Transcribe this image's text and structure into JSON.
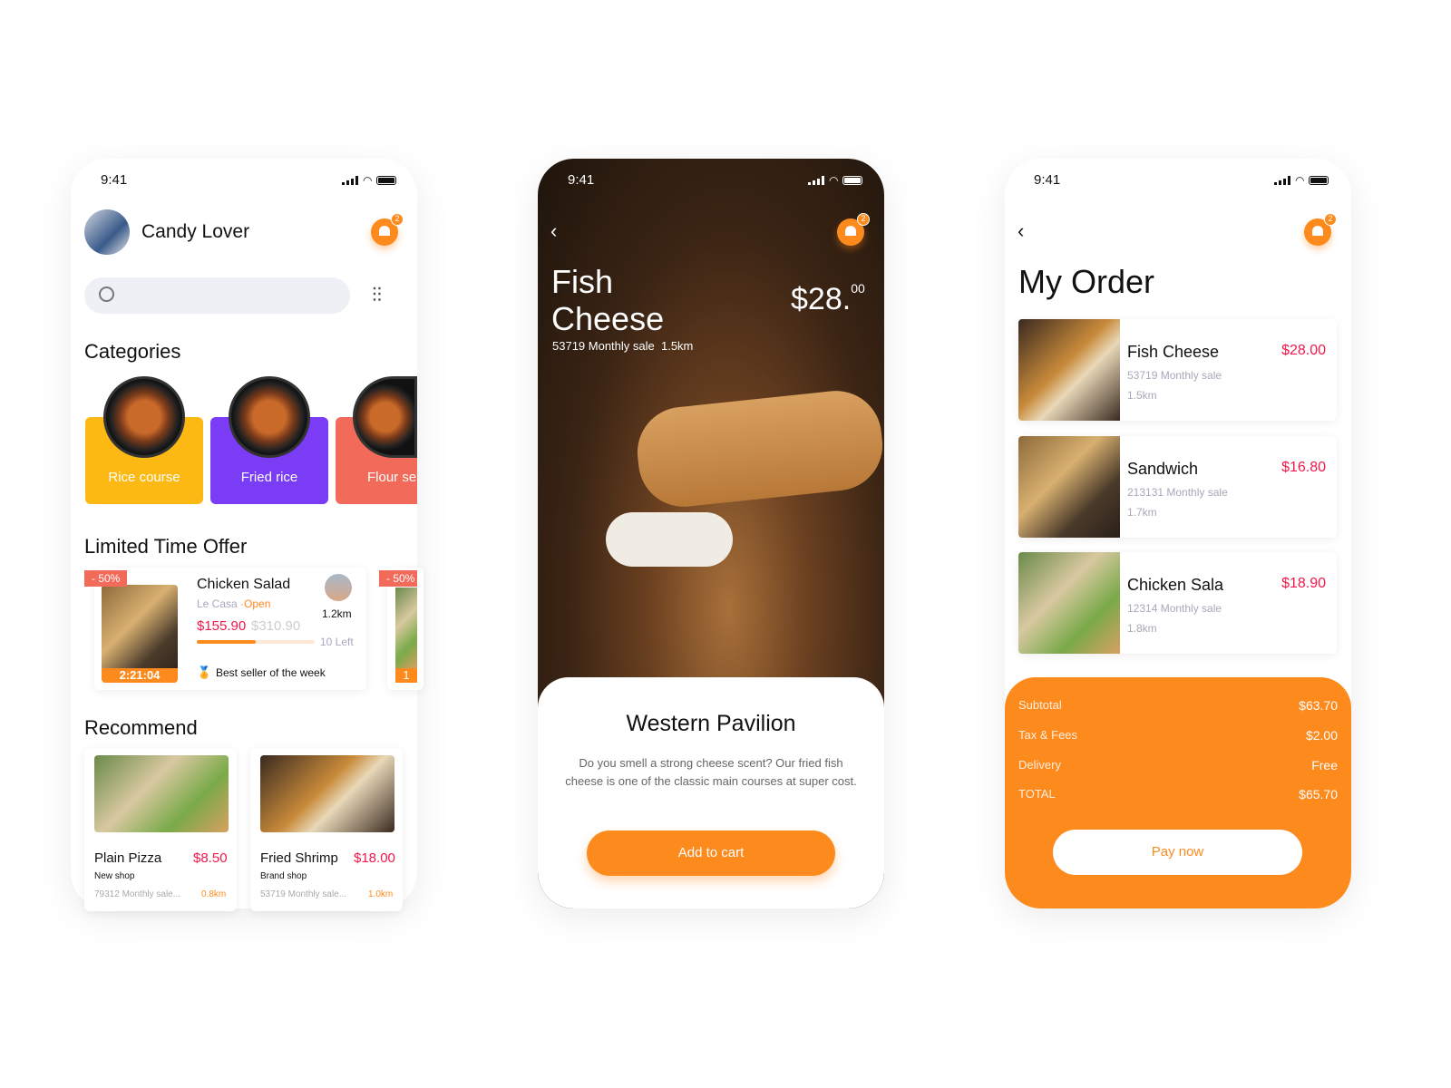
{
  "screens": {
    "home": {
      "time": "9:41",
      "user_name": "Candy Lover",
      "notif_count": "2",
      "search_placeholder": "",
      "categories_title": "Categories",
      "categories": [
        {
          "label": "Rice course",
          "color": "#fdb913"
        },
        {
          "label": "Fried rice",
          "color": "#7a3cf5"
        },
        {
          "label": "Flour se",
          "color": "#f26a5a"
        }
      ],
      "offer_title": "Limited Time Offer",
      "offer": {
        "discount": "- 50%",
        "timer": "2:21:04",
        "name": "Chicken Salad",
        "shop": "Le Casa",
        "status": "·Open",
        "price": "$155.90",
        "old_price": "$310.90",
        "distance": "1.2km",
        "left": "10 Left",
        "progress": 0.5,
        "badge": "Best seller of the week"
      },
      "offer2": {
        "discount": "- 50%",
        "timer": "1"
      },
      "recommend_title": "Recommend",
      "recommend": [
        {
          "name": "Plain Pizza",
          "price": "$8.50",
          "shop": "New shop",
          "sales": "79312 Monthly sale...",
          "distance": "0.8km"
        },
        {
          "name": "Fried Shrimp",
          "price": "$18.00",
          "shop": "Brand shop",
          "sales": "53719 Monthly sale...",
          "distance": "1.0km"
        }
      ]
    },
    "detail": {
      "time": "9:41",
      "notif_count": "2",
      "title_line1": "Fish",
      "title_line2": "Cheese",
      "price_main": "$28.",
      "price_cents": "00",
      "sales": "53719 Monthly sale",
      "distance": "1.5km",
      "restaurant": "Western Pavilion",
      "description": "Do you smell a strong cheese scent? Our fried fish cheese is one of the classic main courses at super cost.",
      "cta": "Add to cart"
    },
    "order": {
      "time": "9:41",
      "notif_count": "2",
      "title": "My Order",
      "items": [
        {
          "name": "Fish Cheese",
          "price": "$28.00",
          "sales": "53719 Monthly sale",
          "distance": "1.5km"
        },
        {
          "name": "Sandwich",
          "price": "$16.80",
          "sales": "213131 Monthly sale",
          "distance": "1.7km"
        },
        {
          "name": "Chicken Sala",
          "price": "$18.90",
          "sales": "12314 Monthly sale",
          "distance": "1.8km"
        }
      ],
      "summary": [
        {
          "label": "Subtotal",
          "value": "$63.70"
        },
        {
          "label": "Tax & Fees",
          "value": "$2.00"
        },
        {
          "label": "Delivery",
          "value": "Free"
        },
        {
          "label": "TOTAL",
          "value": "$65.70"
        }
      ],
      "cta": "Pay now"
    }
  },
  "colors": {
    "accent": "#fd8a1d",
    "price": "#f0184a"
  }
}
